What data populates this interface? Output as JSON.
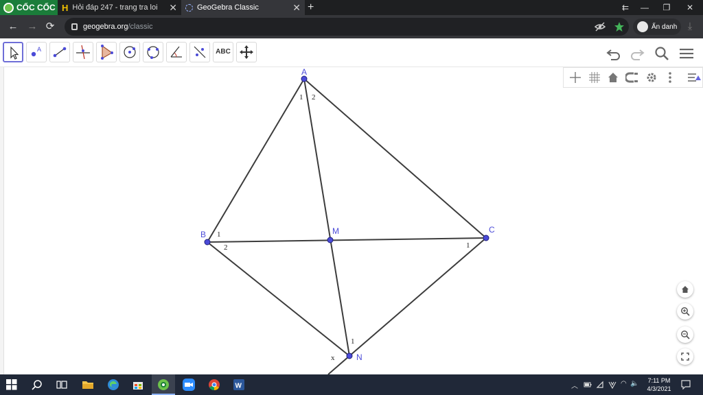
{
  "browser": {
    "brand": "CỐC CỐC",
    "tabs": [
      {
        "label": "Hỏi đáp 247 - trang tra loi",
        "close": "✕"
      },
      {
        "label": "GeoGebra Classic",
        "close": "✕"
      }
    ],
    "new_tab": "+",
    "window_controls": {
      "extra": "⇇",
      "minimize": "—",
      "restore": "❐",
      "close": "✕"
    },
    "nav": {
      "back": "←",
      "forward": "→",
      "reload": "⟳"
    },
    "url": {
      "host": "geogebra.org",
      "path": "/classic"
    },
    "incognito_label": "Ẩn danh",
    "download": "⤓"
  },
  "toolbar": {
    "text_tool": "ABC",
    "icons": [
      "move-icon",
      "point-icon",
      "line-icon",
      "perpendicular-icon",
      "polygon-icon",
      "circle-center-icon",
      "circle-three-points-icon",
      "angle-icon",
      "reflect-icon",
      "text-icon",
      "move-view-icon",
      "undo-icon",
      "redo-icon",
      "search-icon",
      "menu-icon"
    ]
  },
  "figure": {
    "points": [
      {
        "name": "A",
        "label": "A"
      },
      {
        "name": "B",
        "label": "B"
      },
      {
        "name": "C",
        "label": "C"
      },
      {
        "name": "M",
        "label": "M"
      },
      {
        "name": "N",
        "label": "N"
      }
    ],
    "angle_marks": [
      {
        "id": "a1",
        "text": "1"
      },
      {
        "id": "a2",
        "text": "2"
      },
      {
        "id": "b1",
        "text": "1"
      },
      {
        "id": "b2",
        "text": "2"
      },
      {
        "id": "c1",
        "text": "1"
      },
      {
        "id": "n1",
        "text": "1"
      },
      {
        "id": "nx",
        "text": "x"
      }
    ],
    "point_color": "#4b4bd8",
    "line_color": "#3c3c3c"
  },
  "taskbar": {
    "time": "7:11 PM",
    "date": "4/3/2021",
    "tray": {
      "chevron": "︿",
      "wifi": "◠",
      "volume": "🔈"
    }
  }
}
